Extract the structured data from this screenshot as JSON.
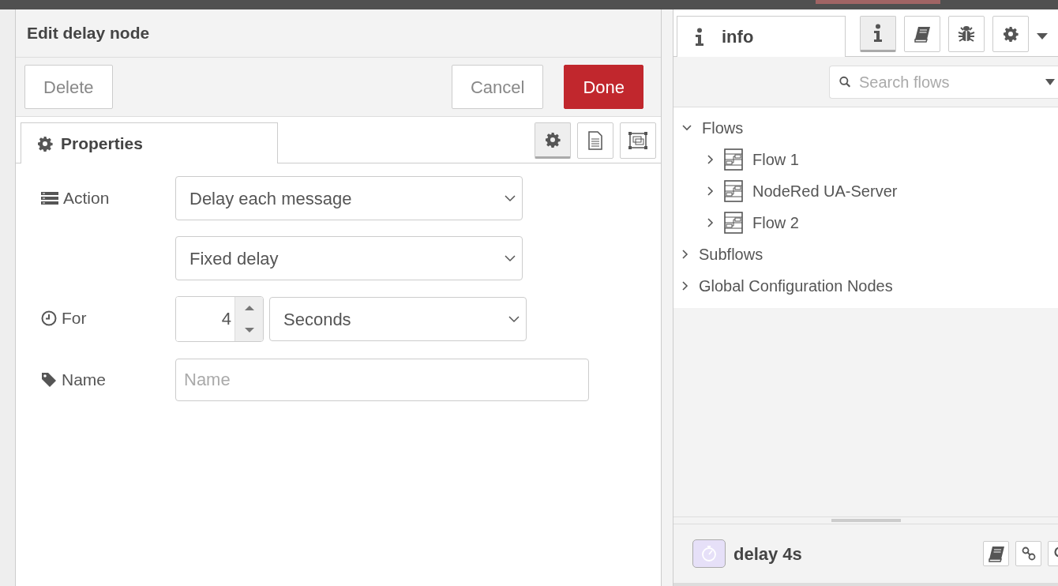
{
  "editor": {
    "title": "Edit delay node",
    "buttons": [
      {
        "label": "Delete",
        "kind": "default"
      },
      {
        "label": "Cancel",
        "kind": "default"
      },
      {
        "label": "Done",
        "kind": "primary"
      }
    ],
    "tabs": [
      {
        "label": "Properties",
        "selected": true
      }
    ],
    "tab_tools": [
      {
        "kind": "gear",
        "selected": true
      },
      {
        "kind": "document",
        "selected": false
      },
      {
        "kind": "frame",
        "selected": false
      }
    ],
    "fields": [
      {
        "kind": "select",
        "label": "Action",
        "value": "Delay each message"
      },
      {
        "kind": "select",
        "value": "Fixed delay"
      },
      {
        "kind": "spinner",
        "label": "For",
        "value": "4",
        "unit": "Seconds"
      },
      {
        "kind": "text",
        "label": "Name",
        "placeholder": "Name"
      }
    ]
  },
  "sidebar": {
    "tabs": [
      {
        "label": "info",
        "selected": true
      }
    ],
    "tool_buttons": [
      {
        "kind": "info",
        "selected": true
      },
      {
        "kind": "book",
        "selected": false
      },
      {
        "kind": "bug",
        "selected": false
      },
      {
        "kind": "gear",
        "selected": false
      }
    ],
    "search": {
      "placeholder": "Search flows"
    },
    "tree": [
      {
        "label": "Flows",
        "expanded": true,
        "children": [
          {
            "label": "Flow 1",
            "expanded": false
          },
          {
            "label": "NodeRed UA-Server",
            "expanded": false
          },
          {
            "label": "Flow 2",
            "expanded": false
          }
        ]
      },
      {
        "label": "Subflows",
        "expanded": false
      },
      {
        "label": "Global Configuration Nodes",
        "expanded": false
      }
    ],
    "node": {
      "label": "delay 4s"
    }
  }
}
